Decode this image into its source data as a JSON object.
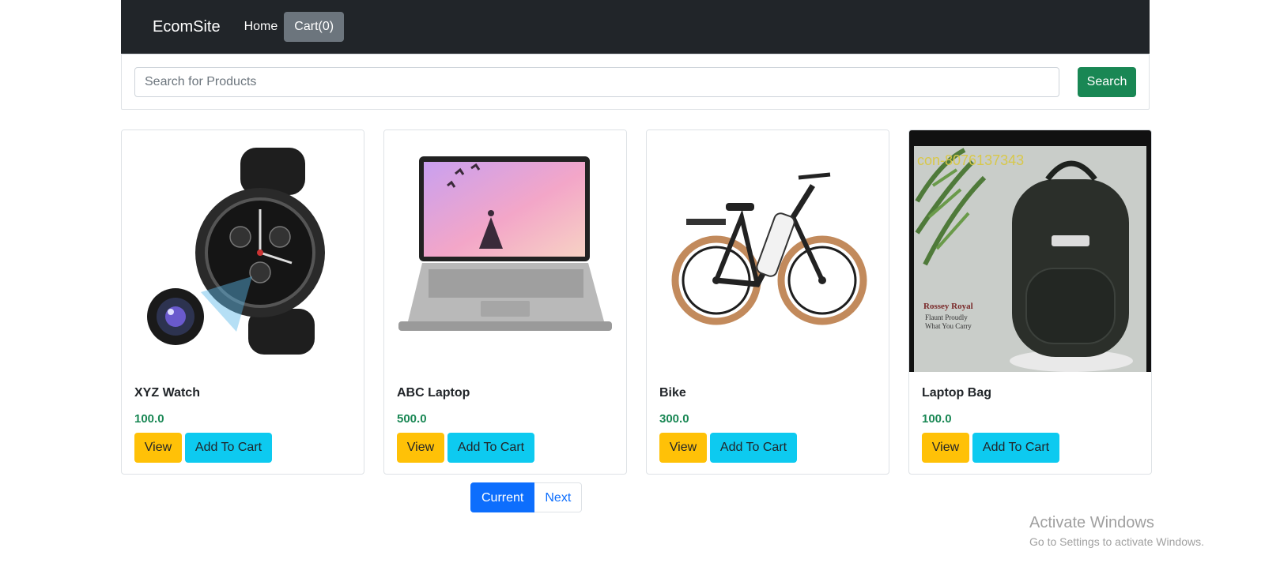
{
  "navbar": {
    "brand": "EcomSite",
    "links": [
      {
        "label": "Home",
        "active": false
      },
      {
        "label": "Cart(0)",
        "active": true
      }
    ]
  },
  "search": {
    "placeholder": "Search for Products",
    "value": "",
    "button_label": "Search"
  },
  "products": [
    {
      "name": "XYZ Watch",
      "price": "100.0",
      "view_label": "View",
      "cart_label": "Add To Cart",
      "image_icon": "watch-image"
    },
    {
      "name": "ABC Laptop",
      "price": "500.0",
      "view_label": "View",
      "cart_label": "Add To Cart",
      "image_icon": "laptop-image"
    },
    {
      "name": "Bike",
      "price": "300.0",
      "view_label": "View",
      "cart_label": "Add To Cart",
      "image_icon": "bike-image"
    },
    {
      "name": "Laptop Bag",
      "price": "100.0",
      "view_label": "View",
      "cart_label": "Add To Cart",
      "image_icon": "bag-image",
      "image_text": [
        "con-8076137343",
        "Rossey Royal",
        "Flaunt Proudly",
        "What You Carry"
      ]
    }
  ],
  "pagination": {
    "current_label": "Current",
    "next_label": "Next"
  },
  "watermark": {
    "title": "Activate Windows",
    "subtitle": "Go to Settings to activate Windows."
  },
  "colors": {
    "navbar_bg": "#212529",
    "search_button": "#198754",
    "view_button": "#ffc107",
    "cart_button": "#0dcaf0",
    "price_text": "#198754",
    "pagination_active": "#0d6efd"
  }
}
